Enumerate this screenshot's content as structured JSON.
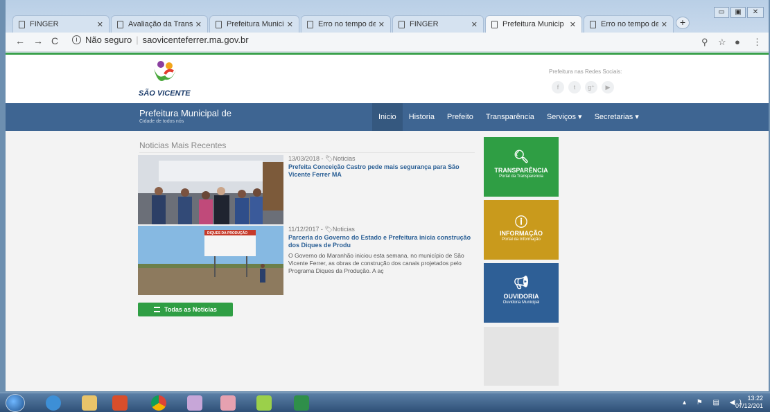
{
  "browser": {
    "tabs": [
      {
        "label": "FINGER"
      },
      {
        "label": "Avaliação da Trans"
      },
      {
        "label": "Prefeitura Municip"
      },
      {
        "label": "Erro no tempo de"
      },
      {
        "label": "FINGER"
      },
      {
        "label": "Prefeitura Municip",
        "active": true
      },
      {
        "label": "Erro no tempo de"
      }
    ],
    "security_label": "Não seguro",
    "url": "saovicenteferrer.ma.gov.br"
  },
  "site": {
    "logo_text": "SÃO VICENTE",
    "social_label": "Prefeitura nas Redes Sociais:",
    "social_icons": [
      "facebook-icon",
      "twitter-icon",
      "google-plus-icon",
      "youtube-icon"
    ],
    "brand_title": "Prefeitura Municipal de",
    "brand_subtitle": "Cidade de todos nós",
    "menu": {
      "inicio": "Inicio",
      "historia": "Historia",
      "prefeito": "Prefeito",
      "transparencia": "Transparência",
      "servicos": "Serviços ▾",
      "secretarias": "Secretarias ▾"
    },
    "active_menu": "Inicio"
  },
  "news": {
    "section_title": "Noticias Mais Recentes",
    "items": [
      {
        "date": "13/03/2018",
        "category": "Noticias",
        "title": "Prefeita Conceição Castro pede mais segurança para São Vicente Ferrer MA",
        "excerpt": ""
      },
      {
        "date": "11/12/2017",
        "category": "Noticias",
        "title": "Parceria do Governo do Estado e Prefeitura inicia construção dos Diques de Produ",
        "excerpt": "O Governo do Maranhão iniciou esta semana, no município de São Vicente Ferrer, as obras de construção dos canais projetados pelo Programa Diques da Produção. A aç",
        "sign_text": "DIQUES DA PRODUÇÃO"
      }
    ],
    "all_news_button": "Todas as Notícias"
  },
  "cards": [
    {
      "title": "TRANSPARÊNCIA",
      "subtitle": "Portal da Transparencia",
      "icon": "search-icon",
      "color": "#2f9e44"
    },
    {
      "title": "INFORMAÇÃO",
      "subtitle": "Portal da Informação",
      "icon": "info-icon",
      "color": "#c99a1c"
    },
    {
      "title": "OUVIDORIA",
      "subtitle": "Ouvidoria Municipal",
      "icon": "megaphone-icon",
      "color": "#2e5f96"
    }
  ],
  "taskbar": {
    "time": "13:22",
    "date": "07/12/201"
  }
}
